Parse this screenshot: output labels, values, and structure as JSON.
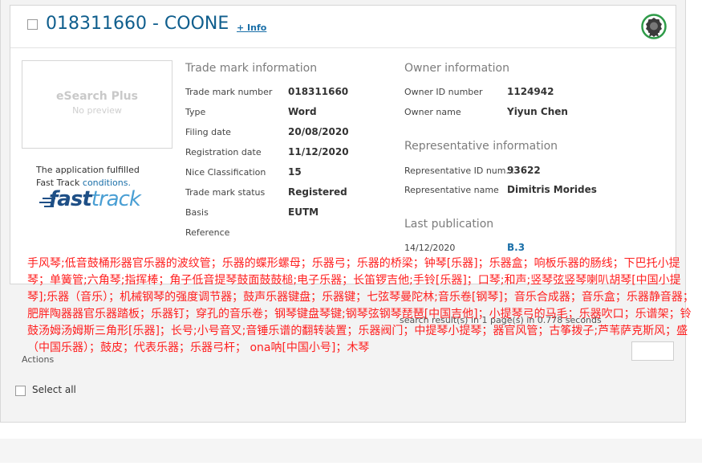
{
  "record": {
    "title": "018311660 - COONE",
    "info_link": "+ Info"
  },
  "preview": {
    "brand": "eSearch Plus",
    "placeholder": "No preview"
  },
  "fast_track": {
    "line1": "The application fulfilled",
    "line2_prefix": "Fast Track ",
    "line2_link": "conditions.",
    "logo_fast": "fast",
    "logo_track": "track"
  },
  "trademark": {
    "heading": "Trade mark information",
    "rows": [
      {
        "label": "Trade mark number",
        "value": "018311660"
      },
      {
        "label": "Type",
        "value": "Word"
      },
      {
        "label": "Filing date",
        "value": "20/08/2020"
      },
      {
        "label": "Registration date",
        "value": "11/12/2020"
      },
      {
        "label": "Nice Classification",
        "value": "15"
      },
      {
        "label": "Trade mark status",
        "value": "Registered"
      },
      {
        "label": "Basis",
        "value": "EUTM"
      },
      {
        "label": "Reference",
        "value": ""
      }
    ]
  },
  "owner": {
    "heading": "Owner information",
    "rows": [
      {
        "label": "Owner ID number",
        "value": "1124942"
      },
      {
        "label": "Owner name",
        "value": "Yiyun Chen"
      }
    ]
  },
  "representative": {
    "heading": "Representative information",
    "rows": [
      {
        "label": "Representative ID num...",
        "value": "93622"
      },
      {
        "label": "Representative name",
        "value": "Dimitris Morides"
      }
    ]
  },
  "publication": {
    "heading": "Last publication",
    "date": "14/12/2020",
    "section": "B.3"
  },
  "goods_overlay": "手风琴;低音鼓桶形器官乐器的波纹管；乐器的蝶形螺母；乐器弓；乐器的桥梁；钟琴[乐器]；乐器盒；响板乐器的肠线；下巴托小提琴；单簧管;六角琴;指挥棒；角子低音提琴鼓面鼓鼓槌;电子乐器；长笛锣吉他;手铃[乐器]；口琴;和声;竖琴弦竖琴喇叭胡琴[中国小提琴];乐器（音乐）；机械钢琴的强度调节器；鼓声乐器键盘；乐器键；七弦琴曼陀林;音乐卷[钢琴]；音乐合成器；音乐盒；乐器静音器；肥胖陶器器官乐器踏板；乐器钉；穿孔的音乐卷；钢琴键盘琴键;钢琴弦钢琴琵琶[中国吉他]；小提琴弓的马毛；乐器吹口；乐谱架；铃鼓汤姆汤姆斯三角形[乐器]；长号;小号音叉;音锤乐谱的翻转装置；乐器阀门；中提琴小提琴；器官风管；古筝拨子;芦苇萨克斯风；盛（中国乐器）；鼓皮；代表乐器；乐器弓杆； ona呐[中国小号]；木琴",
  "results_text": "search result(s) in 1 page(s) in 0.778 seconds",
  "actions_label": "Actions",
  "select_all_label": "Select all",
  "colors": {
    "title": "#0f5e8d",
    "link": "#1a6fa8",
    "overlay_text": "#ff2020",
    "badge_ring": "#2e9b48"
  },
  "icons": {
    "badge": "award-seal-icon",
    "checkbox": "checkbox-icon"
  }
}
